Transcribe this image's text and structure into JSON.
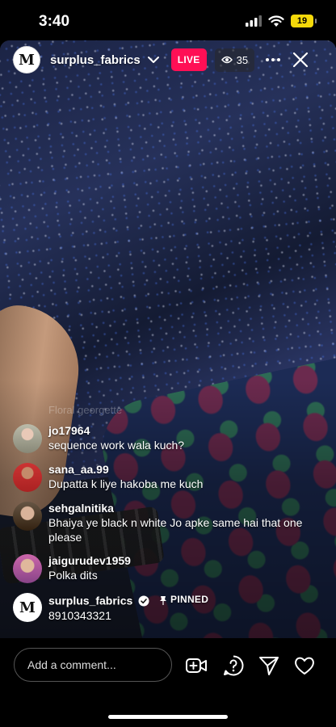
{
  "status_bar": {
    "time": "3:40",
    "battery": "19"
  },
  "header": {
    "avatar_letter": "M",
    "username": "surplus_fabrics",
    "live_label": "LIVE",
    "viewer_count": "35"
  },
  "comments": {
    "faded_preview": "Floral georgette",
    "items": [
      {
        "user": "jo17964",
        "text": "sequence work wala kuch?"
      },
      {
        "user": "sana_aa.99",
        "text": "Dupatta k liye hakoba me kuch"
      },
      {
        "user": "sehgalnitika",
        "text": "Bhaiya ye black n white Jo apke same hai that one please"
      },
      {
        "user": "jaigurudev1959",
        "text": "Polka dits"
      }
    ],
    "pinned": {
      "user": "surplus_fabrics",
      "pinned_label": "PINNED",
      "text": "8910343321",
      "avatar_letter": "M"
    }
  },
  "bottom_bar": {
    "comment_placeholder": "Add a comment...",
    "icons": [
      "add-video-icon",
      "question-icon",
      "send-icon",
      "heart-icon"
    ]
  },
  "colors": {
    "live_red": "#ff0f55",
    "battery_yellow": "#f5d90a"
  }
}
